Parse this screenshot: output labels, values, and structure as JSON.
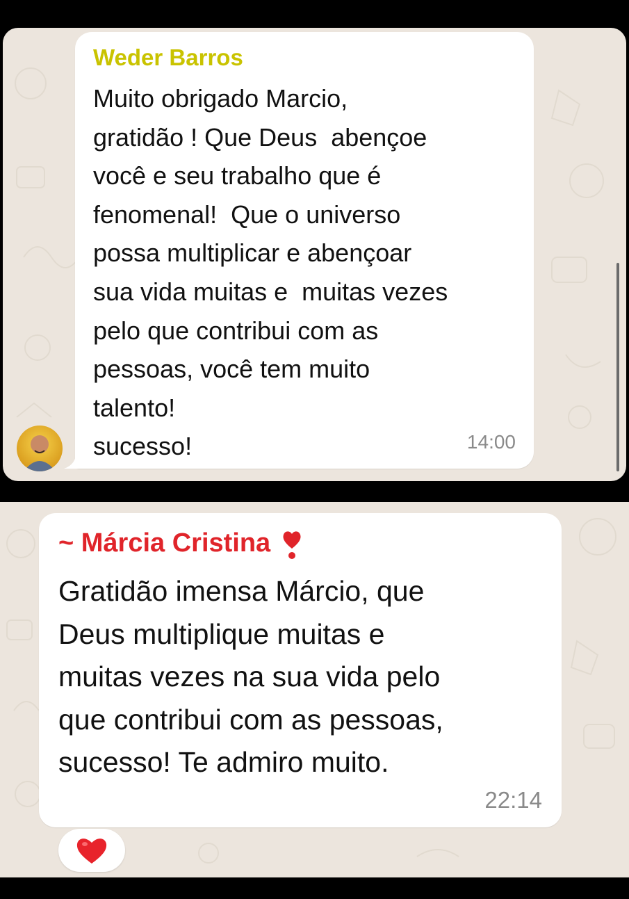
{
  "messages": [
    {
      "sender": "Weder Barros",
      "sender_color": "#c9c300",
      "lines": [
        "Muito obrigado Marcio,",
        "gratidão ! Que Deus  abençoe",
        "você e seu trabalho que é",
        "fenomenal!  Que o universo",
        "possa multiplicar e abençoar",
        "sua vida muitas e  muitas vezes",
        "pelo que contribui com as",
        "pessoas, você tem muito",
        "talento!",
        "sucesso!"
      ],
      "time": "14:00",
      "avatar_icon": "profile-photo"
    },
    {
      "sender": "~ Márcia Cristina",
      "sender_suffix_icon": "red-exclamation-heart-icon",
      "sender_color": "#e0242a",
      "lines": [
        "Gratidão imensa Márcio, que",
        "Deus multiplique muitas e",
        "muitas vezes na sua vida pelo",
        "que contribui com as pessoas,",
        "sucesso! Te admiro muito."
      ],
      "time": "22:14",
      "reaction_icon": "red-heart-icon"
    }
  ],
  "colors": {
    "chat_background": "#ece5dd",
    "bubble": "#ffffff",
    "timestamp": "#8a8a8a"
  }
}
